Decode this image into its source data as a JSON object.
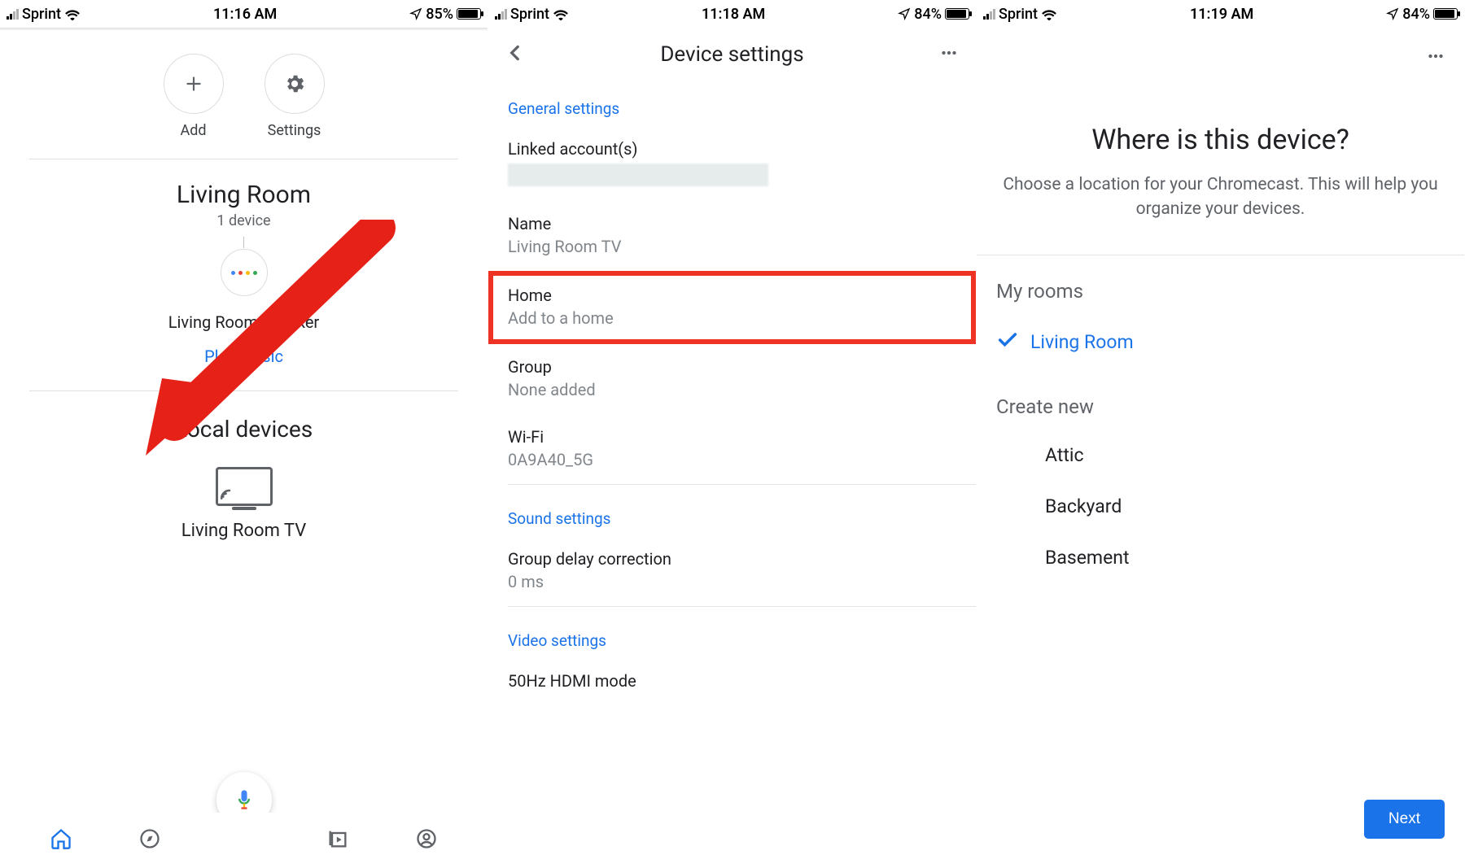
{
  "screen1": {
    "status": {
      "carrier": "Sprint",
      "time": "11:16 AM",
      "battery_pct": "85%",
      "battery_fill": 85
    },
    "actions": {
      "add": "Add",
      "settings": "Settings"
    },
    "room": {
      "name": "Living Room",
      "count": "1 device"
    },
    "speaker": {
      "name": "Living Room speaker",
      "play": "Play music"
    },
    "local_header": "Local devices",
    "cast_name": "Living Room TV"
  },
  "screen2": {
    "status": {
      "carrier": "Sprint",
      "time": "11:18 AM",
      "battery_pct": "84%",
      "battery_fill": 84
    },
    "title": "Device settings",
    "general": "General settings",
    "linked_label": "Linked account(s)",
    "name_label": "Name",
    "name_value": "Living Room TV",
    "home_label": "Home",
    "home_value": "Add to a home",
    "group_label": "Group",
    "group_value": "None added",
    "wifi_label": "Wi-Fi",
    "wifi_value": "0A9A40_5G",
    "sound": "Sound settings",
    "delay_label": "Group delay correction",
    "delay_value": "0 ms",
    "video": "Video settings",
    "hdmi": "50Hz HDMI mode"
  },
  "screen3": {
    "status": {
      "carrier": "Sprint",
      "time": "11:19 AM",
      "battery_pct": "84%",
      "battery_fill": 84
    },
    "heading": "Where is this device?",
    "sub": "Choose a location for your Chromecast. This will help you organize your devices.",
    "myrooms": "My rooms",
    "selected_room": "Living Room",
    "createnew": "Create new",
    "rooms": [
      "Attic",
      "Backyard",
      "Basement"
    ],
    "next": "Next"
  }
}
